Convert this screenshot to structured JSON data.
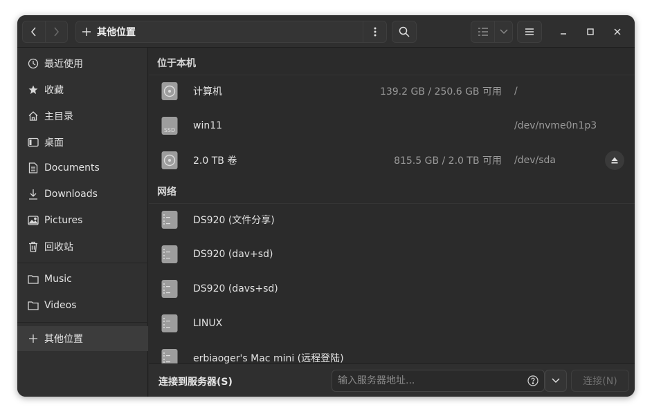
{
  "header": {
    "location": "其他位置"
  },
  "sidebar": {
    "items": [
      {
        "label": "最近使用",
        "icon": "clock-icon"
      },
      {
        "label": "收藏",
        "icon": "star-icon"
      },
      {
        "label": "主目录",
        "icon": "home-icon"
      },
      {
        "label": "桌面",
        "icon": "desktop-icon"
      },
      {
        "label": "Documents",
        "icon": "document-icon"
      },
      {
        "label": "Downloads",
        "icon": "download-icon"
      },
      {
        "label": "Pictures",
        "icon": "picture-icon"
      },
      {
        "label": "回收站",
        "icon": "trash-icon"
      },
      {
        "label": "Music",
        "icon": "folder-icon"
      },
      {
        "label": "Videos",
        "icon": "folder-icon"
      },
      {
        "label": "其他位置",
        "icon": "plus-icon"
      }
    ]
  },
  "main": {
    "local_heading": "位于本机",
    "local": [
      {
        "name": "计算机",
        "usage": "139.2 GB / 250.6 GB 可用",
        "mount": "/",
        "icon": "disk-icon"
      },
      {
        "name": "win11",
        "usage": "",
        "mount": "/dev/nvme0n1p3",
        "icon": "ssd-icon"
      },
      {
        "name": "2.0 TB 卷",
        "usage": "815.5 GB / 2.0 TB 可用",
        "mount": "/dev/sda",
        "icon": "disk-icon"
      }
    ],
    "network_heading": "网络",
    "network": [
      {
        "name": "DS920 (文件分享)",
        "icon": "server-icon"
      },
      {
        "name": "DS920 (dav+sd)",
        "icon": "server-icon"
      },
      {
        "name": "DS920 (davs+sd)",
        "icon": "server-icon"
      },
      {
        "name": "LINUX",
        "icon": "server-icon"
      },
      {
        "name": "erbiaoger's Mac mini (远程登陆)",
        "icon": "server-icon"
      }
    ]
  },
  "bottom": {
    "label": "连接到服务器(S)",
    "placeholder": "输入服务器地址...",
    "connect_label": "连接(N)"
  }
}
